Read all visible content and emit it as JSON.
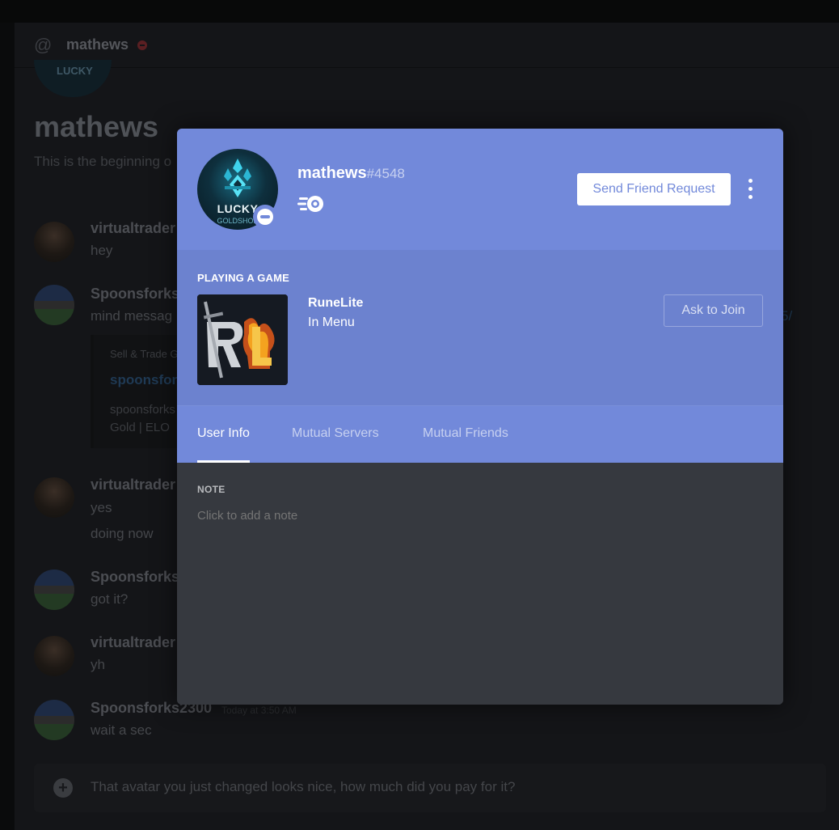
{
  "background": {
    "header_name": "mathews",
    "avatar_text": "LUCKY",
    "dm_title": "mathews",
    "dm_sub": "This is the beginning o",
    "messages": [
      {
        "name": "virtualtrader",
        "text": "hey"
      },
      {
        "name": "Spoonsforks2",
        "text": "mind messag"
      },
      {
        "name": "virtualtrader",
        "text": "yes",
        "text2": "doing now"
      },
      {
        "name": "Spoonsforks2",
        "text": "got it?"
      },
      {
        "name": "virtualtrader",
        "text": "yh"
      },
      {
        "name": "Spoonsforks2300",
        "time": "Today at 3:50 AM",
        "text": "wait a sec"
      }
    ],
    "embed": {
      "source": "Sell & Trade G",
      "link": "spoonsfor",
      "desc1": "spoonsforks",
      "desc2": "Gold | ELO"
    },
    "right_link": "5/",
    "input_text": "That avatar you just changed looks nice, how much did you pay for it?"
  },
  "profile": {
    "username": "mathews",
    "discriminator": "#4548",
    "avatar_text": "LUCKY",
    "avatar_subtext": "GOLDSHOP",
    "send_friend_label": "Send Friend Request",
    "activity": {
      "header": "PLAYING A GAME",
      "game_name": "RuneLite",
      "game_state": "In Menu",
      "join_label": "Ask to Join"
    },
    "tabs": [
      "User Info",
      "Mutual Servers",
      "Mutual Friends"
    ],
    "note": {
      "label": "NOTE",
      "placeholder": "Click to add a note"
    }
  },
  "colors": {
    "blurple": "#7289da",
    "dark": "#36393f",
    "white": "#ffffff"
  }
}
